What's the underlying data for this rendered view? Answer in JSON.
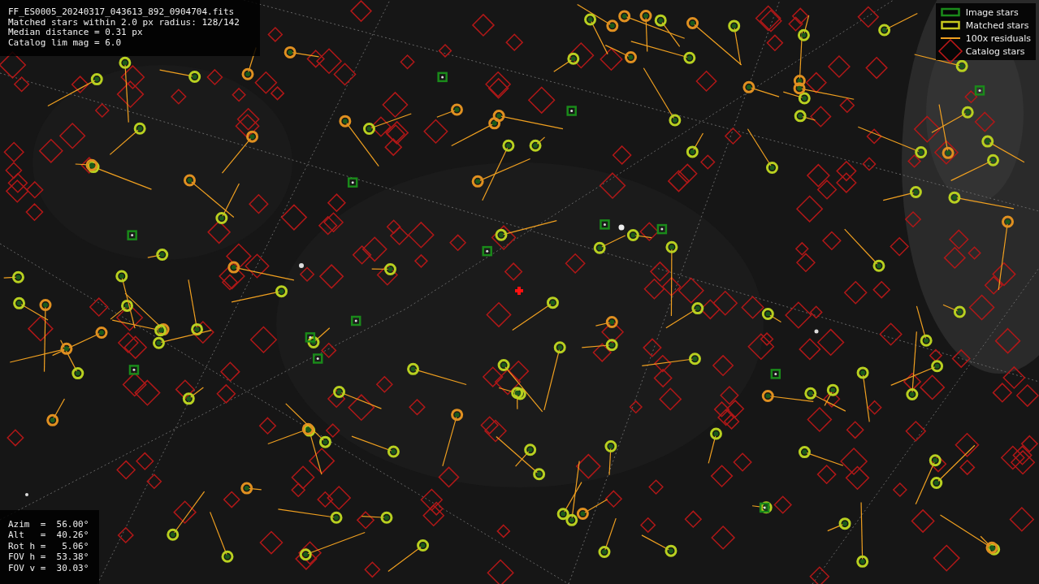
{
  "header_lines": [
    "FF_ES0005_20240317_043613_892_0904704.fits",
    "Matched stars within 2.0 px radius: 128/142",
    "Median distance = 0.31 px",
    "Catalog lim mag = 6.0"
  ],
  "legend": [
    {
      "kind": "box",
      "color": "#1a8a1a",
      "label": "Image stars"
    },
    {
      "kind": "box",
      "color": "#c8c81e",
      "label": "Matched stars"
    },
    {
      "kind": "line",
      "color": "#f0a020",
      "label": "100x residuals"
    },
    {
      "kind": "diamond",
      "color": "#c01818",
      "label": "Catalog stars"
    }
  ],
  "pointing_lines": [
    "Azim  =  56.00°",
    "Alt   =  40.26°",
    "Rot h =   5.06°",
    "FOV h =  53.38°",
    "FOV v =  30.03°"
  ]
}
